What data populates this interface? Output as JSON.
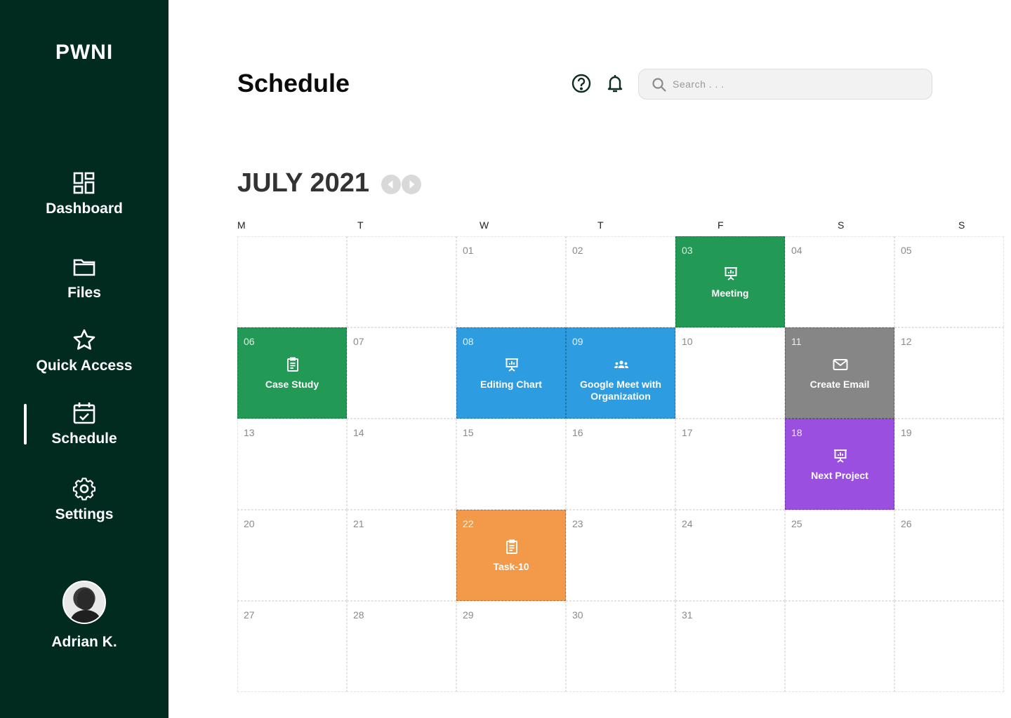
{
  "sidebar": {
    "brand": "PWNI",
    "items": [
      {
        "label": "Dashboard",
        "icon": "dashboard-icon"
      },
      {
        "label": "Files",
        "icon": "folder-icon"
      },
      {
        "label": "Quick Access",
        "icon": "star-icon"
      },
      {
        "label": "Schedule",
        "icon": "calendar-icon",
        "active": true
      },
      {
        "label": "Settings",
        "icon": "gear-icon"
      }
    ],
    "user": {
      "name": "Adrian K."
    }
  },
  "header": {
    "title": "Schedule",
    "search": {
      "placeholder": "Search . . ."
    }
  },
  "calendar": {
    "month_label": "JULY 2021",
    "weekdays": [
      "M",
      "T",
      "W",
      "T",
      "F",
      "S",
      "S"
    ],
    "days": [
      "",
      "",
      "01",
      "02",
      "03",
      "04",
      "05",
      "06",
      "07",
      "08",
      "09",
      "10",
      "11",
      "12",
      "13",
      "14",
      "15",
      "16",
      "17",
      "18",
      "19",
      "20",
      "21",
      "22",
      "23",
      "24",
      "25",
      "26",
      "27",
      "28",
      "29",
      "30",
      "31",
      "",
      ""
    ],
    "events": {
      "03": {
        "title": "Meeting",
        "color": "#229954",
        "icon": "presentation-icon"
      },
      "06": {
        "title": "Case Study",
        "color": "#229954",
        "icon": "clipboard-icon"
      },
      "08": {
        "title": "Editing Chart",
        "color": "#2e9ce0",
        "icon": "presentation-icon"
      },
      "09": {
        "title": "Google Meet with Organization",
        "color": "#2e9ce0",
        "icon": "group-icon"
      },
      "11": {
        "title": "Create Email",
        "color": "#868686",
        "icon": "mail-icon"
      },
      "18": {
        "title": "Next Project",
        "color": "#9b4fe0",
        "icon": "presentation-icon"
      },
      "22": {
        "title": "Task-10",
        "color": "#f2994a",
        "icon": "clipboard-icon"
      }
    }
  },
  "colors": {
    "sidebar_bg": "#022b20",
    "green": "#229954",
    "blue": "#2e9ce0",
    "gray": "#868686",
    "purple": "#9b4fe0",
    "orange": "#f2994a"
  }
}
